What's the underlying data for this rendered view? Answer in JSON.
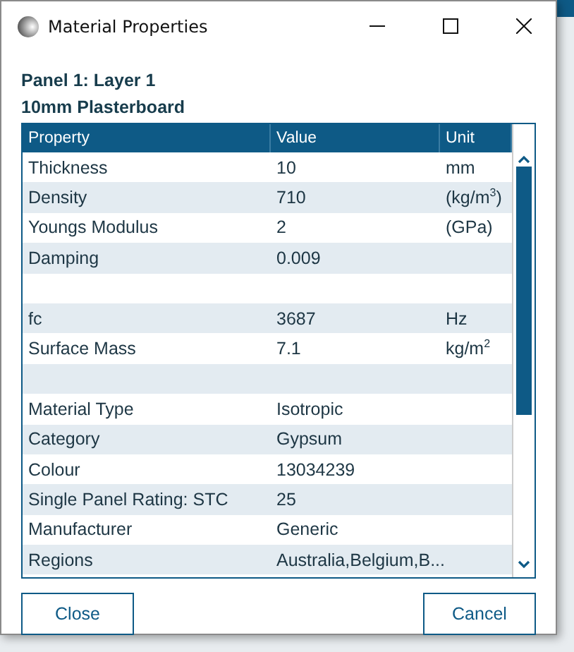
{
  "window": {
    "title": "Material Properties"
  },
  "panel_heading": "Panel 1: Layer 1",
  "material_name": "10mm Plasterboard",
  "table": {
    "columns": [
      "Property",
      "Value",
      "Unit"
    ],
    "rows": [
      {
        "kind": "property",
        "property": "Thickness",
        "value": "10",
        "unit": "mm"
      },
      {
        "kind": "property",
        "property": "Density",
        "value": "710",
        "unit": "(kg/m$^{3}$)"
      },
      {
        "kind": "property",
        "property": "Youngs Modulus",
        "value": "2",
        "unit": "(GPa)"
      },
      {
        "kind": "property",
        "property": "Damping",
        "value": "0.009"
      },
      {
        "kind": "blank"
      },
      {
        "kind": "property",
        "property": "fc",
        "value": "3687",
        "unit": "Hz"
      },
      {
        "kind": "property",
        "property": "Surface Mass",
        "value": "7.1",
        "unit": "kg/m$^{2}$"
      },
      {
        "kind": "blank"
      },
      {
        "kind": "property",
        "property": "Material Type",
        "value": "Isotropic"
      },
      {
        "kind": "property",
        "property": "Category",
        "value": "Gypsum"
      },
      {
        "kind": "property",
        "property": "Colour",
        "value": "13034239"
      },
      {
        "kind": "property",
        "property": "Single Panel Rating: STC",
        "value": "25"
      },
      {
        "kind": "property",
        "property": "Manufacturer",
        "value": "Generic"
      },
      {
        "kind": "property",
        "property": "Regions",
        "value": "Australia,Belgium,B..."
      }
    ]
  },
  "buttons": [
    "Close",
    "Cancel"
  ]
}
